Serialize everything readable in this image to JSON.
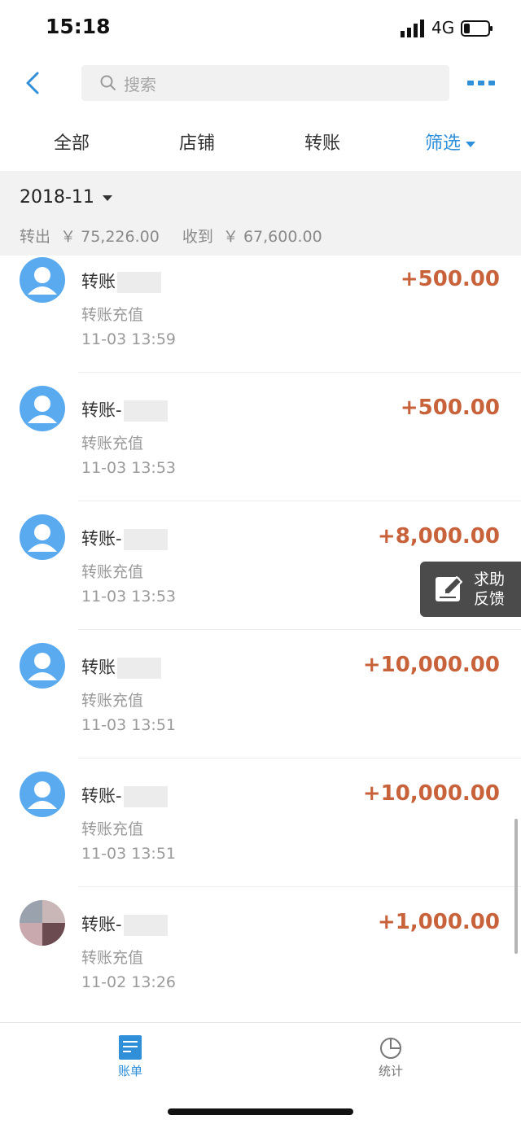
{
  "status": {
    "time": "15:18",
    "network": "4G"
  },
  "nav": {
    "search_placeholder": "搜索"
  },
  "tabs": [
    {
      "label": "全部"
    },
    {
      "label": "店铺"
    },
    {
      "label": "转账"
    },
    {
      "label": "筛选"
    }
  ],
  "summary": {
    "month": "2018-11",
    "out_label": "转出",
    "out_amount": "￥ 75,226.00",
    "in_label": "收到",
    "in_amount": "￥ 67,600.00"
  },
  "transactions": [
    {
      "title": "转账",
      "subtitle": "转账充值",
      "time": "11-03  13:59",
      "amount": "+500.00"
    },
    {
      "title": "转账-",
      "subtitle": "转账充值",
      "time": "11-03  13:53",
      "amount": "+500.00"
    },
    {
      "title": "转账-",
      "subtitle": "转账充值",
      "time": "11-03  13:53",
      "amount": "+8,000.00"
    },
    {
      "title": "转账",
      "subtitle": "转账充值",
      "time": "11-03  13:51",
      "amount": "+10,000.00"
    },
    {
      "title": "转账-",
      "subtitle": "转账充值",
      "time": "11-03  13:51",
      "amount": "+10,000.00"
    },
    {
      "title": "转账-",
      "subtitle": "转账充值",
      "time": "11-02  13:26",
      "amount": "+1,000.00"
    }
  ],
  "feedback": {
    "line1": "求助",
    "line2": "反馈"
  },
  "tabbar": [
    {
      "label": "账单"
    },
    {
      "label": "统计"
    }
  ],
  "colors": {
    "accent": "#2f8fd8",
    "amount": "#c8623b",
    "avatar": "#5aaaf0"
  }
}
